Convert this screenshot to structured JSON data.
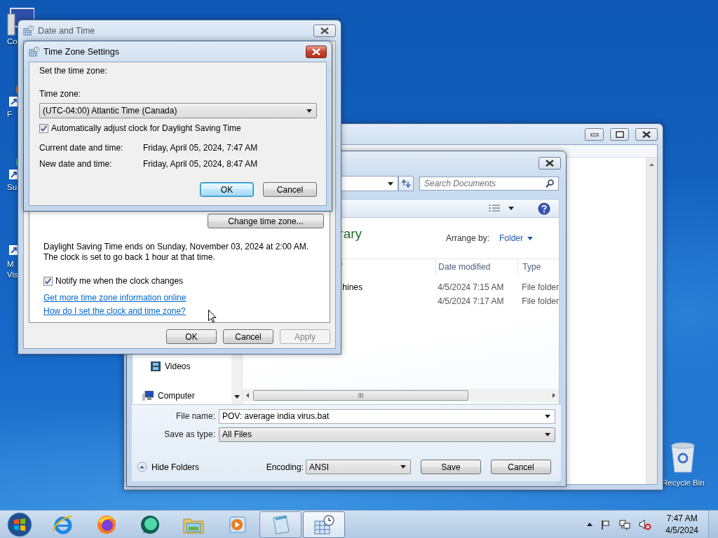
{
  "desktop_icons": [
    {
      "kind": "computer",
      "lines": [
        "Co"
      ]
    },
    {
      "kind": "orange-app",
      "lines": [
        "F"
      ]
    },
    {
      "kind": "green-app",
      "lines": [
        "Su"
      ]
    },
    {
      "kind": "blue-app",
      "lines": [
        "M",
        "Vis"
      ]
    }
  ],
  "recycle_bin": {
    "label": "Recycle Bin"
  },
  "save_dialog": {
    "search_placeholder": "Search Documents",
    "library_title": "rary",
    "arrange_label": "Arrange by:",
    "arrange_value": "Folder",
    "columns": [
      "Date modified",
      "Type"
    ],
    "rows": [
      {
        "name": "hines",
        "date": "4/5/2024 7:15 AM",
        "type": "File folder"
      },
      {
        "date": "4/5/2024 7:17 AM",
        "type": "File folder"
      }
    ],
    "nav_items": [
      {
        "kind": "videos",
        "label": "Videos"
      },
      {
        "kind": "computer",
        "label": "Computer"
      }
    ],
    "file_name_label": "File name:",
    "file_name": "POV: average india virus.bat",
    "save_type_label": "Save as type:",
    "save_type": "All Files",
    "hide_folders": "Hide Folders",
    "encoding_label": "Encoding:",
    "encoding": "ANSI",
    "buttons": [
      "Save",
      "Cancel"
    ]
  },
  "date_time": {
    "title": "Date and Time",
    "change_button": "Change time zone...",
    "dst_note": "Daylight Saving Time ends on Sunday, November 03, 2024 at 2:00 AM. The clock is set to go back 1 hour at that time.",
    "notify": {
      "label": "Notify me when the clock changes",
      "checked": true
    },
    "links": [
      "Get more time zone information online",
      "How do I set the clock and time zone?"
    ],
    "buttons": [
      {
        "label": "OK",
        "disabled": false
      },
      {
        "label": "Cancel",
        "disabled": false
      },
      {
        "label": "Apply",
        "disabled": true
      }
    ]
  },
  "time_zone": {
    "title": "Time Zone Settings",
    "prompt": "Set the time zone:",
    "zone_label": "Time zone:",
    "zone": "(UTC-04:00) Atlantic Time (Canada)",
    "auto_dst": {
      "label": "Automatically adjust clock for Daylight Saving Time",
      "checked": true
    },
    "rows": [
      {
        "label": "Current date and time:",
        "value": "Friday, April 05, 2024, 7:47 AM"
      },
      {
        "label": "New date and time:",
        "value": "Friday, April 05, 2024, 8:47 AM"
      }
    ],
    "buttons": [
      {
        "label": "OK",
        "default": true
      },
      {
        "label": "Cancel",
        "default": false
      }
    ]
  },
  "taskbar": {
    "apps": [
      {
        "kind": "ie",
        "open": false,
        "active": false
      },
      {
        "kind": "firefox",
        "open": false,
        "active": false
      },
      {
        "kind": "green",
        "open": false,
        "active": false
      },
      {
        "kind": "explorer",
        "open": false,
        "active": false
      },
      {
        "kind": "media",
        "open": false,
        "active": false
      },
      {
        "kind": "notepad",
        "open": true,
        "active": false
      },
      {
        "kind": "datetime",
        "open": true,
        "active": true
      }
    ],
    "clock": {
      "time": "7:47 AM",
      "date": "4/5/2024"
    }
  }
}
